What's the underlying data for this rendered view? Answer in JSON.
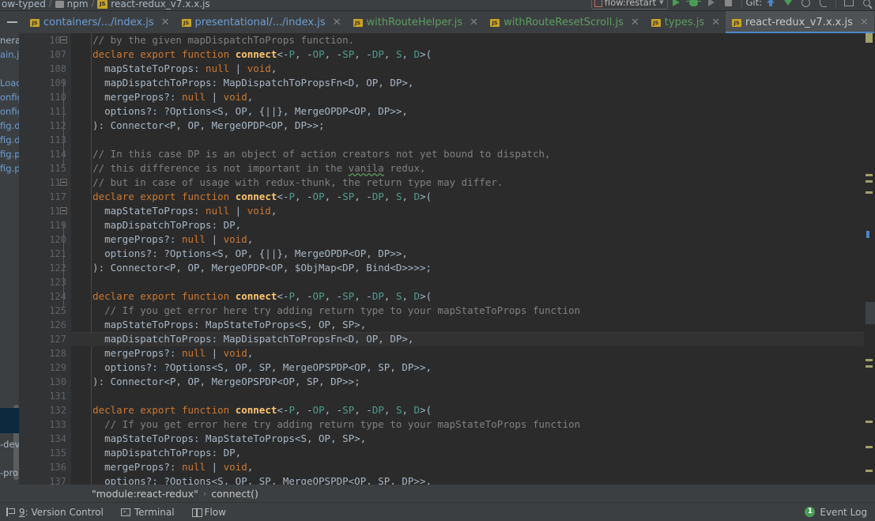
{
  "window": {
    "path_crumbs": [
      {
        "label": "ow-typed",
        "icon": "folder-icon"
      },
      {
        "label": "npm",
        "icon": "folder-icon"
      },
      {
        "label": "react-redux_v7.x.x.js",
        "icon": "js-file-icon"
      }
    ]
  },
  "toolbar": {
    "run_config": "flow:restart",
    "run_config_icon": "flow-config-icon",
    "buttons": [
      {
        "name": "run-button",
        "icon": "play-icon"
      },
      {
        "name": "debug-button",
        "icon": "bug-icon"
      },
      {
        "name": "run-with-coverage-button",
        "icon": "run-coverage-icon"
      },
      {
        "name": "stop-button",
        "icon": "stop-icon"
      }
    ],
    "git_label": "Git:",
    "git_buttons": [
      {
        "name": "update-project-button",
        "icon": "update-arrow-icon"
      },
      {
        "name": "commit-button",
        "icon": "commit-arrow-icon"
      },
      {
        "name": "history-button",
        "icon": "history-icon"
      },
      {
        "name": "rollback-button",
        "icon": "rollback-icon"
      },
      {
        "name": "open-preview-button",
        "icon": "preview-box-icon"
      },
      {
        "name": "search-everywhere-button",
        "icon": "search-icon"
      }
    ]
  },
  "tabs": [
    {
      "label": "containers/.../index.js",
      "color": "blue",
      "active": false,
      "icon": "js-file-icon"
    },
    {
      "label": "presentational/.../index.js",
      "color": "blue",
      "active": false,
      "icon": "js-file-icon"
    },
    {
      "label": "withRouteHelper.js",
      "color": "green",
      "active": false,
      "icon": "js-file-icon"
    },
    {
      "label": "withRouteResetScroll.js",
      "color": "green",
      "active": false,
      "icon": "js-file-icon"
    },
    {
      "label": "types.js",
      "color": "green",
      "active": false,
      "icon": "js-file-icon"
    },
    {
      "label": "react-redux_v7.x.x.js",
      "color": "white",
      "active": true,
      "icon": "js-file-icon"
    }
  ],
  "project_panel": {
    "rows": [
      {
        "label": "nera",
        "color": "default",
        "selected": false
      },
      {
        "label": "ain.js",
        "color": "blue",
        "selected": false
      },
      {
        "label": "",
        "color": "default",
        "selected": false
      },
      {
        "label": "Load",
        "color": "blue",
        "selected": false
      },
      {
        "label": "onfig",
        "color": "blue",
        "selected": false
      },
      {
        "label": "onfig",
        "color": "blue",
        "selected": false
      },
      {
        "label": "fig.de",
        "color": "blue",
        "selected": false
      },
      {
        "label": "fig.de",
        "color": "blue",
        "selected": false
      },
      {
        "label": "fig.pr",
        "color": "blue",
        "selected": false
      },
      {
        "label": "fig.pr",
        "color": "blue",
        "selected": false
      }
    ],
    "bottom_rows": [
      {
        "label": "-dev",
        "color": "default"
      },
      {
        "label": "-pro",
        "color": "default"
      }
    ]
  },
  "editor": {
    "first_line_number": 106,
    "current_line_number": 127,
    "lines": [
      {
        "n": 106,
        "fold": "none",
        "tokens": [
          {
            "t": "  ",
            "c": "plain"
          },
          {
            "t": "// by the given mapDispatchToProps function.",
            "c": "comment"
          }
        ]
      },
      {
        "n": 107,
        "fold": "open",
        "tokens": [
          {
            "t": "  ",
            "c": "plain"
          },
          {
            "t": "declare export function ",
            "c": "keyword"
          },
          {
            "t": "connect",
            "c": "function"
          },
          {
            "t": "<-",
            "c": "plain"
          },
          {
            "t": "P",
            "c": "type"
          },
          {
            "t": ", -",
            "c": "plain"
          },
          {
            "t": "OP",
            "c": "type"
          },
          {
            "t": ", -",
            "c": "plain"
          },
          {
            "t": "SP",
            "c": "type"
          },
          {
            "t": ", -",
            "c": "plain"
          },
          {
            "t": "DP",
            "c": "type"
          },
          {
            "t": ", ",
            "c": "plain"
          },
          {
            "t": "S",
            "c": "type"
          },
          {
            "t": ", ",
            "c": "plain"
          },
          {
            "t": "D",
            "c": "type"
          },
          {
            "t": ">(",
            "c": "plain"
          }
        ]
      },
      {
        "n": 108,
        "fold": "none",
        "tokens": [
          {
            "t": "    mapStateToProps: ",
            "c": "plain"
          },
          {
            "t": "null",
            "c": "keyword"
          },
          {
            "t": " | ",
            "c": "plain"
          },
          {
            "t": "void",
            "c": "keyword"
          },
          {
            "t": ",",
            "c": "plain"
          }
        ]
      },
      {
        "n": 109,
        "fold": "none",
        "tokens": [
          {
            "t": "    mapDispatchToProps: MapDispatchToPropsFn<D, OP, DP>,",
            "c": "plain"
          }
        ]
      },
      {
        "n": 110,
        "fold": "none",
        "tokens": [
          {
            "t": "    mergeProps?: ",
            "c": "plain"
          },
          {
            "t": "null",
            "c": "keyword"
          },
          {
            "t": " | ",
            "c": "plain"
          },
          {
            "t": "void",
            "c": "keyword"
          },
          {
            "t": ",",
            "c": "plain"
          }
        ]
      },
      {
        "n": 111,
        "fold": "none",
        "tokens": [
          {
            "t": "    options?: ?Options<S, OP, {||}, MergeOPDP<OP, DP>>,",
            "c": "plain"
          }
        ]
      },
      {
        "n": 112,
        "fold": "none",
        "tokens": [
          {
            "t": "  ): Connector<P, OP, MergeOPDP<OP, DP>>;",
            "c": "plain"
          }
        ]
      },
      {
        "n": 113,
        "fold": "none",
        "tokens": []
      },
      {
        "n": 114,
        "fold": "open",
        "tokens": [
          {
            "t": "  ",
            "c": "plain"
          },
          {
            "t": "// In this case DP is an object of action creators not yet bound to dispatch,",
            "c": "comment"
          }
        ]
      },
      {
        "n": 115,
        "fold": "none",
        "tokens": [
          {
            "t": "  ",
            "c": "plain"
          },
          {
            "t": "// this difference is not important in the ",
            "c": "comment"
          },
          {
            "t": "vanila",
            "c": "typo"
          },
          {
            "t": " redux,",
            "c": "comment"
          }
        ]
      },
      {
        "n": 116,
        "fold": "open",
        "tokens": [
          {
            "t": "  ",
            "c": "plain"
          },
          {
            "t": "// but in case of usage with redux-thunk, the return type may differ.",
            "c": "comment"
          }
        ]
      },
      {
        "n": 117,
        "fold": "none",
        "tokens": [
          {
            "t": "  ",
            "c": "plain"
          },
          {
            "t": "declare export function ",
            "c": "keyword"
          },
          {
            "t": "connect",
            "c": "function"
          },
          {
            "t": "<-",
            "c": "plain"
          },
          {
            "t": "P",
            "c": "type"
          },
          {
            "t": ", -",
            "c": "plain"
          },
          {
            "t": "OP",
            "c": "type"
          },
          {
            "t": ", -",
            "c": "plain"
          },
          {
            "t": "SP",
            "c": "type"
          },
          {
            "t": ", -",
            "c": "plain"
          },
          {
            "t": "DP",
            "c": "type"
          },
          {
            "t": ", ",
            "c": "plain"
          },
          {
            "t": "S",
            "c": "type"
          },
          {
            "t": ", ",
            "c": "plain"
          },
          {
            "t": "D",
            "c": "type"
          },
          {
            "t": ">(",
            "c": "plain"
          }
        ]
      },
      {
        "n": 118,
        "fold": "none",
        "tokens": [
          {
            "t": "    mapStateToProps: ",
            "c": "plain"
          },
          {
            "t": "null",
            "c": "keyword"
          },
          {
            "t": " | ",
            "c": "plain"
          },
          {
            "t": "void",
            "c": "keyword"
          },
          {
            "t": ",",
            "c": "plain"
          }
        ]
      },
      {
        "n": 119,
        "fold": "none",
        "tokens": [
          {
            "t": "    mapDispatchToProps: DP,",
            "c": "plain"
          }
        ]
      },
      {
        "n": 120,
        "fold": "none",
        "tokens": [
          {
            "t": "    mergeProps?: ",
            "c": "plain"
          },
          {
            "t": "null",
            "c": "keyword"
          },
          {
            "t": " | ",
            "c": "plain"
          },
          {
            "t": "void",
            "c": "keyword"
          },
          {
            "t": ",",
            "c": "plain"
          }
        ]
      },
      {
        "n": 121,
        "fold": "none",
        "tokens": [
          {
            "t": "    options?: ?Options<S, OP, {||}, MergeOPDP<OP, DP>>,",
            "c": "plain"
          }
        ]
      },
      {
        "n": 122,
        "fold": "none",
        "tokens": [
          {
            "t": "  ): Connector<P, OP, MergeOPDP<OP, $ObjMap<DP, Bind<D>>>>;",
            "c": "plain"
          }
        ]
      },
      {
        "n": 123,
        "fold": "none",
        "tokens": []
      },
      {
        "n": 124,
        "fold": "none",
        "tokens": [
          {
            "t": "  ",
            "c": "plain"
          },
          {
            "t": "declare export function ",
            "c": "keyword"
          },
          {
            "t": "connect",
            "c": "function"
          },
          {
            "t": "<-",
            "c": "plain"
          },
          {
            "t": "P",
            "c": "type"
          },
          {
            "t": ", -",
            "c": "plain"
          },
          {
            "t": "OP",
            "c": "type"
          },
          {
            "t": ", -",
            "c": "plain"
          },
          {
            "t": "SP",
            "c": "type"
          },
          {
            "t": ", -",
            "c": "plain"
          },
          {
            "t": "DP",
            "c": "type"
          },
          {
            "t": ", ",
            "c": "plain"
          },
          {
            "t": "S",
            "c": "type"
          },
          {
            "t": ", ",
            "c": "plain"
          },
          {
            "t": "D",
            "c": "type"
          },
          {
            "t": ">(",
            "c": "plain"
          }
        ]
      },
      {
        "n": 125,
        "fold": "none",
        "tokens": [
          {
            "t": "    ",
            "c": "plain"
          },
          {
            "t": "// If you get error here try adding return type to your mapStateToProps function",
            "c": "comment"
          }
        ]
      },
      {
        "n": 126,
        "fold": "none",
        "tokens": [
          {
            "t": "    mapStateToProps: MapStateToProps<S, OP, SP>,",
            "c": "plain"
          }
        ]
      },
      {
        "n": 127,
        "fold": "none",
        "tokens": [
          {
            "t": "    mapDispatchToProps: MapDispatchToPropsFn<D, OP, DP>,",
            "c": "plain"
          }
        ]
      },
      {
        "n": 128,
        "fold": "none",
        "tokens": [
          {
            "t": "    mergeProps?: ",
            "c": "plain"
          },
          {
            "t": "null",
            "c": "keyword"
          },
          {
            "t": " | ",
            "c": "plain"
          },
          {
            "t": "void",
            "c": "keyword"
          },
          {
            "t": ",",
            "c": "plain"
          }
        ]
      },
      {
        "n": 129,
        "fold": "none",
        "tokens": [
          {
            "t": "    options?: ?Options<S, OP, SP, MergeOPSPDP<OP, SP, DP>>,",
            "c": "plain"
          }
        ]
      },
      {
        "n": 130,
        "fold": "none",
        "tokens": [
          {
            "t": "  ): Connector<P, OP, MergeOPSPDP<OP, SP, DP>>;",
            "c": "plain"
          }
        ]
      },
      {
        "n": 131,
        "fold": "none",
        "tokens": []
      },
      {
        "n": 132,
        "fold": "none",
        "tokens": [
          {
            "t": "  ",
            "c": "plain"
          },
          {
            "t": "declare export function ",
            "c": "keyword"
          },
          {
            "t": "connect",
            "c": "function"
          },
          {
            "t": "<-",
            "c": "plain"
          },
          {
            "t": "P",
            "c": "type"
          },
          {
            "t": ", -",
            "c": "plain"
          },
          {
            "t": "OP",
            "c": "type"
          },
          {
            "t": ", -",
            "c": "plain"
          },
          {
            "t": "SP",
            "c": "type"
          },
          {
            "t": ", -",
            "c": "plain"
          },
          {
            "t": "DP",
            "c": "type"
          },
          {
            "t": ", ",
            "c": "plain"
          },
          {
            "t": "S",
            "c": "type"
          },
          {
            "t": ", ",
            "c": "plain"
          },
          {
            "t": "D",
            "c": "type"
          },
          {
            "t": ">(",
            "c": "plain"
          }
        ]
      },
      {
        "n": 133,
        "fold": "none",
        "tokens": [
          {
            "t": "    ",
            "c": "plain"
          },
          {
            "t": "// If you get error here try adding return type to your mapStateToProps function",
            "c": "comment"
          }
        ]
      },
      {
        "n": 134,
        "fold": "none",
        "tokens": [
          {
            "t": "    mapStateToProps: MapStateToProps<S, OP, SP>,",
            "c": "plain"
          }
        ]
      },
      {
        "n": 135,
        "fold": "none",
        "tokens": [
          {
            "t": "    mapDispatchToProps: DP,",
            "c": "plain"
          }
        ]
      },
      {
        "n": 136,
        "fold": "none",
        "tokens": [
          {
            "t": "    mergeProps?: ",
            "c": "plain"
          },
          {
            "t": "null",
            "c": "keyword"
          },
          {
            "t": " | ",
            "c": "plain"
          },
          {
            "t": "void",
            "c": "keyword"
          },
          {
            "t": ",",
            "c": "plain"
          }
        ]
      },
      {
        "n": 137,
        "fold": "none",
        "tokens": [
          {
            "t": "    options?: ?Options<S, OP, SP, MergeOPSPDP<OP, SP, DP>>,",
            "c": "plain"
          }
        ]
      }
    ]
  },
  "breadcrumb": {
    "module": "\"module:react-redux\"",
    "separator": "›",
    "member": "connect()"
  },
  "statusbar": {
    "items": [
      {
        "label": "9: Version Control",
        "prefix": "9",
        "icon": "version-control-icon"
      },
      {
        "label": "Terminal",
        "icon": "terminal-icon"
      },
      {
        "label": "Flow",
        "icon": "flow-icon"
      }
    ],
    "event_log_label": "Event Log",
    "event_log_count": "1"
  },
  "colors": {
    "bg_editor": "#2b2b2b",
    "bg_chrome": "#3c3f41",
    "gutter": "#313335",
    "accent_tab": "#4a88c7",
    "keyword": "#cc7832",
    "comment": "#808080",
    "function": "#ffc66d",
    "type": "#4e9e8f",
    "badge_green": "#499c54"
  }
}
